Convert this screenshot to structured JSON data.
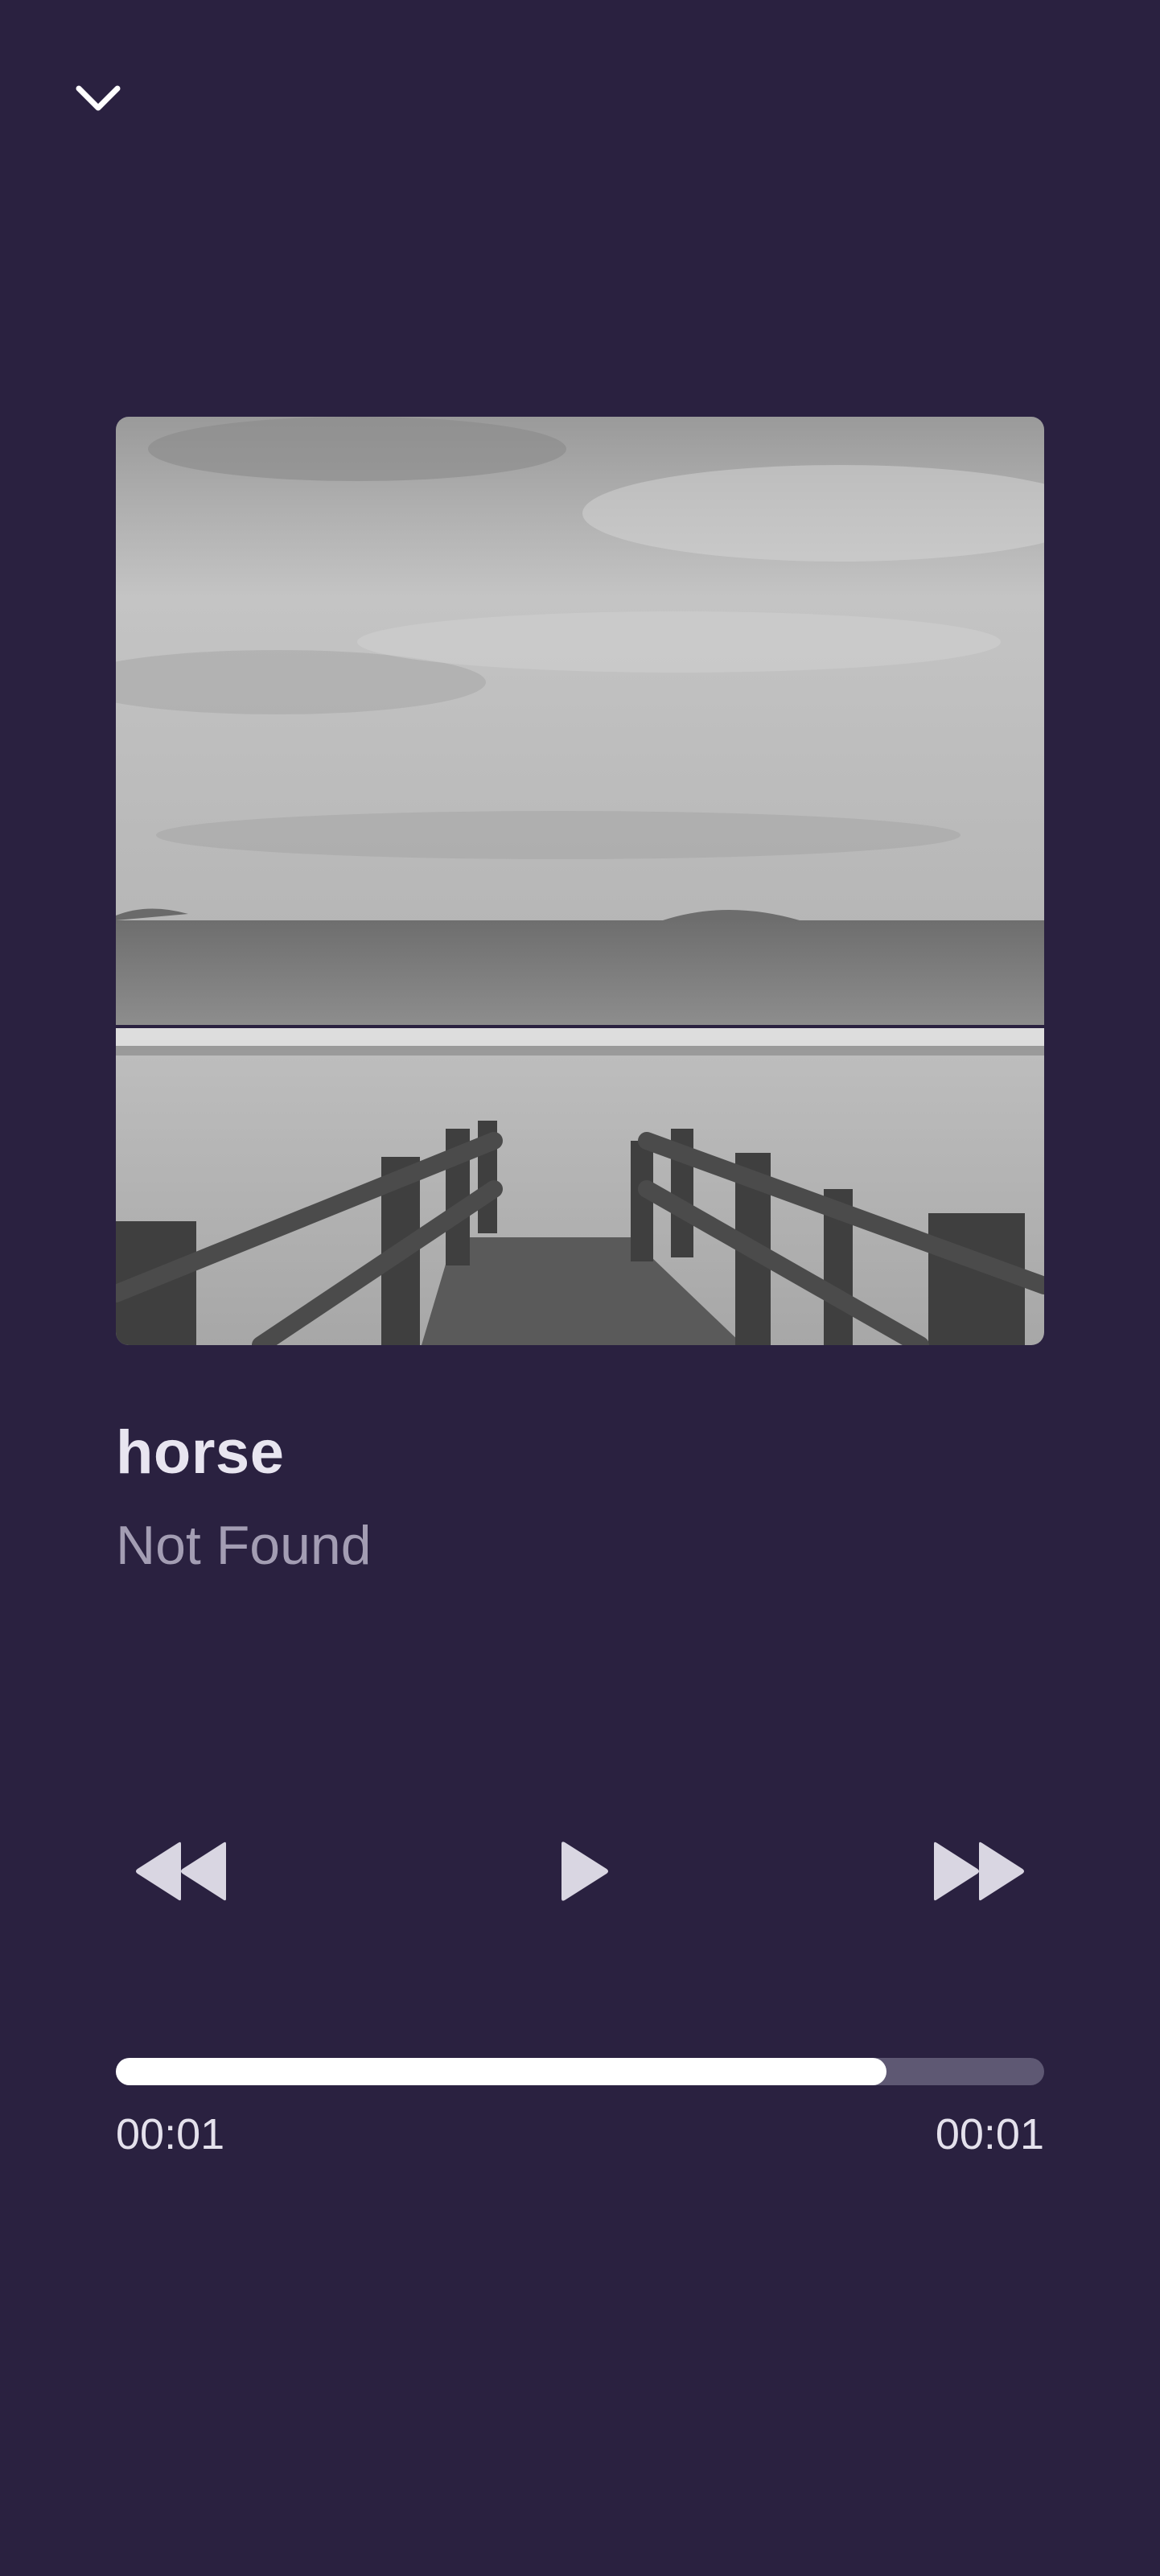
{
  "player": {
    "collapse_icon": "chevron-down-icon",
    "artwork_icon": "album-artwork-beach-boardwalk",
    "track": {
      "title": "horse",
      "artist": "Not Found"
    },
    "controls": {
      "rewind_icon": "rewind-icon",
      "play_icon": "play-icon",
      "forward_icon": "fast-forward-icon"
    },
    "progress": {
      "fraction": 0.83,
      "elapsed": "00:01",
      "total": "00:01"
    }
  },
  "colors": {
    "background": "#2a2140",
    "title": "#e8e5f0",
    "artist": "#a39db3",
    "control": "#d9d6e2",
    "progress_fill": "#ffffff",
    "progress_track": "#5e5873"
  }
}
